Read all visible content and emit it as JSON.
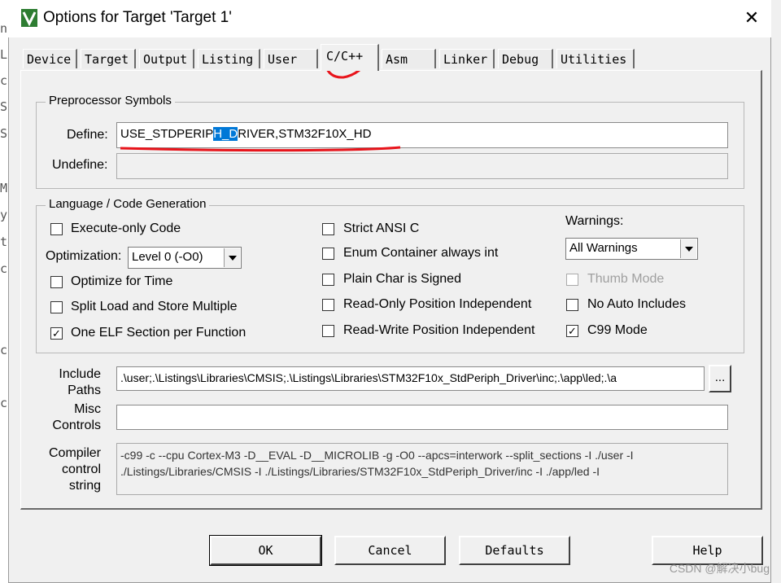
{
  "window": {
    "title": "Options for Target 'Target 1'",
    "close_glyph": "✕"
  },
  "background_chars": [
    "nt",
    "Lo",
    "cl",
    "Sc",
    "Se",
    "M",
    "y:",
    "te",
    "c:",
    "ce",
    "ce"
  ],
  "tabs": [
    {
      "label": "Device"
    },
    {
      "label": "Target"
    },
    {
      "label": "Output"
    },
    {
      "label": "Listing"
    },
    {
      "label": "User"
    },
    {
      "label": "C/C++",
      "active": true
    },
    {
      "label": "Asm"
    },
    {
      "label": "Linker"
    },
    {
      "label": "Debug"
    },
    {
      "label": "Utilities"
    }
  ],
  "preprocessor": {
    "legend": "Preprocessor Symbols",
    "define_label": "Define:",
    "define_before": "USE_STDPERIP",
    "define_selected": "H_D",
    "define_after": "RIVER,STM32F10X_HD",
    "undefine_label": "Undefine:",
    "undefine_value": ""
  },
  "language": {
    "legend": "Language / Code Generation",
    "execute_only": {
      "label": "Execute-only Code",
      "checked": false
    },
    "optimization_label": "Optimization:",
    "optimization_value": "Level 0 (-O0)",
    "optimize_time": {
      "label": "Optimize for Time",
      "checked": false
    },
    "split_load": {
      "label": "Split Load and Store Multiple",
      "checked": false
    },
    "one_elf": {
      "label": "One ELF Section per Function",
      "checked": true
    },
    "strict_ansi": {
      "label": "Strict ANSI C",
      "checked": false
    },
    "enum_container": {
      "label": "Enum Container always int",
      "checked": false
    },
    "plain_char": {
      "label": "Plain Char is Signed",
      "checked": false
    },
    "ro_pi": {
      "label": "Read-Only Position Independent",
      "checked": false
    },
    "rw_pi": {
      "label": "Read-Write Position Independent",
      "checked": false
    },
    "warnings_label": "Warnings:",
    "warnings_value": "All Warnings",
    "thumb_mode": {
      "label": "Thumb Mode",
      "checked": false,
      "disabled": true
    },
    "no_auto_includes": {
      "label": "No Auto Includes",
      "checked": false
    },
    "c99_mode": {
      "label": "C99 Mode",
      "checked": true
    },
    "check_glyph": "✓"
  },
  "include_paths": {
    "label_line1": "Include",
    "label_line2": "Paths",
    "value": ".\\user;.\\Listings\\Libraries\\CMSIS;.\\Listings\\Libraries\\STM32F10x_StdPeriph_Driver\\inc;.\\app\\led;.\\a",
    "browse_label": "..."
  },
  "misc_controls": {
    "label_line1": "Misc",
    "label_line2": "Controls",
    "value": ""
  },
  "compiler_string": {
    "label_line1": "Compiler",
    "label_line2": "control",
    "label_line3": "string",
    "value": "-c99 -c --cpu Cortex-M3 -D__EVAL -D__MICROLIB -g -O0 --apcs=interwork --split_sections -I ./user -I ./Listings/Libraries/CMSIS -I ./Listings/Libraries/STM32F10x_StdPeriph_Driver/inc -I ./app/led -I"
  },
  "buttons": {
    "ok": "OK",
    "cancel": "Cancel",
    "defaults": "Defaults",
    "help": "Help"
  },
  "watermark": "CSDN @解决小bug",
  "colors": {
    "annotation_red": "#e8141b",
    "selection_blue": "#0078d7"
  }
}
